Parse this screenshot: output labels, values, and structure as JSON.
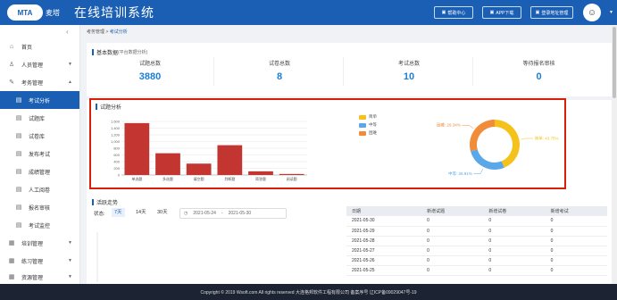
{
  "header": {
    "logo_text": "MTA",
    "brand": "麦塔",
    "title": "在线培训系统",
    "buttons": [
      {
        "label": "帮助中心",
        "icon": "help-icon"
      },
      {
        "label": "APP下载",
        "icon": "download-icon"
      },
      {
        "label": "登录地址管理",
        "icon": "link-icon"
      }
    ]
  },
  "sidebar": {
    "items": [
      {
        "label": "首页",
        "icon": "home-icon"
      },
      {
        "label": "人员管理",
        "icon": "user-icon"
      },
      {
        "label": "考务管理",
        "icon": "exam-icon"
      },
      {
        "label": "考试分析",
        "icon": "chart-icon"
      },
      {
        "label": "试题库",
        "icon": "question-bank-icon"
      },
      {
        "label": "试卷库",
        "icon": "paper-icon"
      },
      {
        "label": "发布考试",
        "icon": "publish-icon"
      },
      {
        "label": "成绩管理",
        "icon": "score-icon"
      },
      {
        "label": "人工阅卷",
        "icon": "marking-icon"
      },
      {
        "label": "报名审核",
        "icon": "audit-icon"
      },
      {
        "label": "考试监控",
        "icon": "monitor-icon"
      },
      {
        "label": "培训管理",
        "icon": "training-icon"
      },
      {
        "label": "练习管理",
        "icon": "practice-icon"
      },
      {
        "label": "资源管理",
        "icon": "resource-icon"
      }
    ]
  },
  "breadcrumb": {
    "parent": "考务管理",
    "sep": ">",
    "current": "考试分析"
  },
  "basic": {
    "title": "基本数据",
    "subtitle": "(平台数据分析)",
    "stats": [
      {
        "label": "试题总数",
        "value": "3880"
      },
      {
        "label": "试卷总数",
        "value": "8"
      },
      {
        "label": "考试总数",
        "value": "10"
      },
      {
        "label": "等待报名审核",
        "value": "0"
      }
    ]
  },
  "analysis": {
    "title": "试题分析"
  },
  "chart_data": [
    {
      "type": "bar",
      "categories": [
        "单选题",
        "多选题",
        "填空题",
        "判断题",
        "简答题",
        "阅读题"
      ],
      "values": [
        1550,
        650,
        340,
        890,
        110,
        30
      ],
      "ylim": [
        0,
        1600
      ],
      "yticks": [
        "0",
        "200",
        "400",
        "600",
        "800",
        "1,000",
        "1,200",
        "1,400",
        "1,600"
      ],
      "colors": {
        "bar": "#c23531",
        "grid": "#e5e5e5"
      }
    },
    {
      "type": "pie",
      "slices": [
        {
          "name": "简单",
          "value": 43.75,
          "label": "简单: 43.75%",
          "color": "#f5c11b"
        },
        {
          "name": "中等",
          "value": 26.91,
          "label": "中等: 26.91%",
          "color": "#5aa8e8"
        },
        {
          "name": "困难",
          "value": 29.34,
          "label": "困难: 29.34%",
          "color": "#f08c3a"
        }
      ]
    }
  ],
  "activity": {
    "title": "活跃走势",
    "status_label": "状态:",
    "tabs": [
      "7天",
      "14天",
      "30天"
    ],
    "date_start": "2021-05-24",
    "date_sep": "-",
    "date_end": "2021-05-30",
    "table": {
      "headers": [
        "日期",
        "新增试题",
        "新增试卷",
        "新增考试"
      ],
      "rows": [
        [
          "2021-05-30",
          "0",
          "0",
          "0"
        ],
        [
          "2021-05-29",
          "0",
          "0",
          "0"
        ],
        [
          "2021-05-28",
          "0",
          "0",
          "0"
        ],
        [
          "2021-05-27",
          "0",
          "0",
          "0"
        ],
        [
          "2021-05-26",
          "0",
          "0",
          "0"
        ],
        [
          "2021-05-25",
          "0",
          "0",
          "0"
        ]
      ]
    }
  },
  "footer": {
    "text": "Copyright © 2019 Wsoft.com All rights reserved 大连格邦软件工程有限公司 备案序号 辽ICP备09029047号-19"
  },
  "colors": {
    "primary": "#1a5fb4",
    "highlight_border": "#d81e06",
    "stat_value": "#1a7fd4"
  }
}
